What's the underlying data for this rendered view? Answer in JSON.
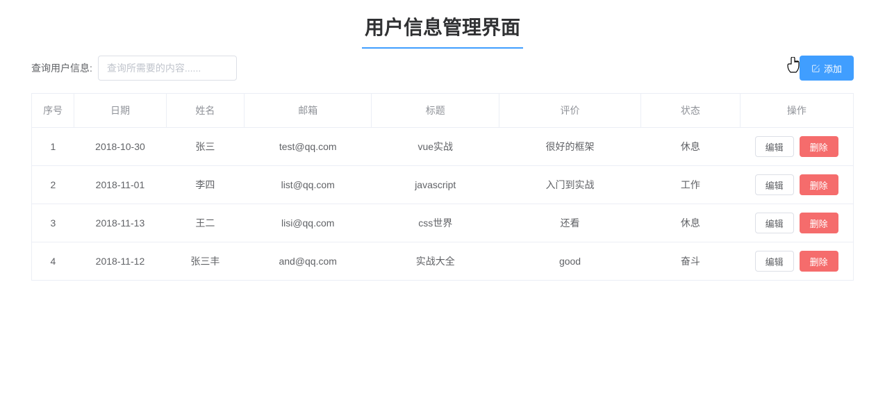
{
  "header": {
    "title": "用户信息管理界面"
  },
  "toolbar": {
    "search_label": "查询用户信息:",
    "search_placeholder": "查询所需要的内容......",
    "add_button_label": "添加"
  },
  "table": {
    "headers": {
      "seq": "序号",
      "date": "日期",
      "name": "姓名",
      "email": "邮箱",
      "title": "标题",
      "eval": "评价",
      "status": "状态",
      "ops": "操作"
    },
    "actions": {
      "edit": "编辑",
      "delete": "删除"
    },
    "rows": [
      {
        "seq": "1",
        "date": "2018-10-30",
        "name": "张三",
        "email": "test@qq.com",
        "title": "vue实战",
        "eval": "很好的框架",
        "status": "休息"
      },
      {
        "seq": "2",
        "date": "2018-11-01",
        "name": "李四",
        "email": "list@qq.com",
        "title": "javascript",
        "eval": "入门到实战",
        "status": "工作"
      },
      {
        "seq": "3",
        "date": "2018-11-13",
        "name": "王二",
        "email": "lisi@qq.com",
        "title": "css世界",
        "eval": "还看",
        "status": "休息"
      },
      {
        "seq": "4",
        "date": "2018-11-12",
        "name": "张三丰",
        "email": "and@qq.com",
        "title": "实战大全",
        "eval": "good",
        "status": "奋斗"
      }
    ]
  }
}
